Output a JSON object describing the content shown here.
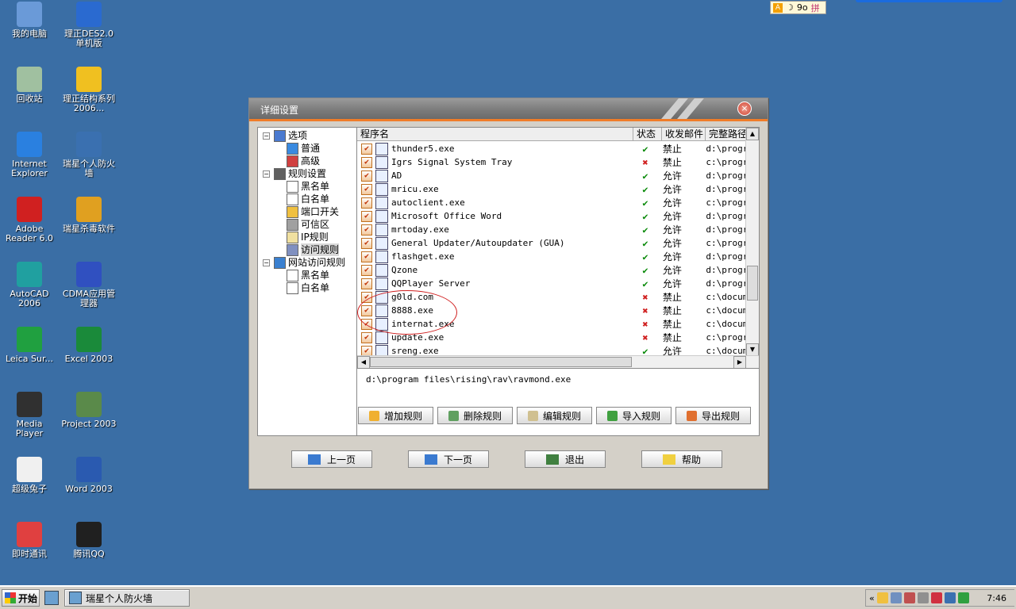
{
  "desktop_icons": [
    {
      "label": "我的电脑",
      "icon": "computer-icon",
      "color": "#6a9ad8"
    },
    {
      "label": "理正DES2.0单机版",
      "icon": "app-des-icon",
      "color": "#2a6ad0"
    },
    {
      "label": "回收站",
      "icon": "recycle-bin-icon",
      "color": "#a0c0a0"
    },
    {
      "label": "理正结构系列2006...",
      "icon": "app-lizheng-icon",
      "color": "#f0c020"
    },
    {
      "label": "Internet Explorer",
      "icon": "ie-icon",
      "color": "#2a80e0"
    },
    {
      "label": "瑞星个人防火墙",
      "icon": "firewall-icon",
      "color": "#3a70b0"
    },
    {
      "label": "Adobe Reader 6.0",
      "icon": "adobe-icon",
      "color": "#d02020"
    },
    {
      "label": "瑞星杀毒软件",
      "icon": "antivirus-icon",
      "color": "#e0a020"
    },
    {
      "label": "AutoCAD 2006",
      "icon": "autocad-icon",
      "color": "#20a0a0"
    },
    {
      "label": "CDMA应用管理器",
      "icon": "cdma-icon",
      "color": "#3050c0"
    },
    {
      "label": "Leica Sur...",
      "icon": "leica-icon",
      "color": "#20a040"
    },
    {
      "label": "Excel 2003",
      "icon": "excel-icon",
      "color": "#1a8a3a"
    },
    {
      "label": "Media Player",
      "icon": "media-player-icon",
      "color": "#303030"
    },
    {
      "label": "Project 2003",
      "icon": "project-icon",
      "color": "#5a8a4a"
    },
    {
      "label": "超级兔子",
      "icon": "rabbit-icon",
      "color": "#f0f0f0"
    },
    {
      "label": "Word 2003",
      "icon": "word-icon",
      "color": "#2a5ab0"
    },
    {
      "label": "即时通讯",
      "icon": "im-icon",
      "color": "#e04040"
    },
    {
      "label": "腾讯QQ",
      "icon": "qq-icon",
      "color": "#202020"
    }
  ],
  "ime": {
    "a": "A",
    "moon": "☽",
    "mode": "9o",
    "pin": "拼"
  },
  "dialog": {
    "title": "详细设置",
    "close": "×",
    "tree": [
      {
        "label": "选项",
        "icon": "options-icon"
      },
      {
        "label": "普通",
        "icon": "normal-settings-icon"
      },
      {
        "label": "高级",
        "icon": "advanced-settings-icon"
      },
      {
        "label": "规则设置",
        "icon": "rules-icon"
      },
      {
        "label": "黑名单",
        "icon": "blacklist-icon"
      },
      {
        "label": "白名单",
        "icon": "whitelist-icon"
      },
      {
        "label": "端口开关",
        "icon": "port-switch-icon"
      },
      {
        "label": "可信区",
        "icon": "trusted-zone-icon"
      },
      {
        "label": "IP规则",
        "icon": "ip-rules-icon"
      },
      {
        "label": "访问规则",
        "icon": "access-rules-icon"
      },
      {
        "label": "网站访问规则",
        "icon": "website-rules-icon"
      },
      {
        "label": "黑名单",
        "icon": "blacklist-icon"
      },
      {
        "label": "白名单",
        "icon": "whitelist-icon"
      }
    ],
    "columns": {
      "name": "程序名",
      "status": "状态",
      "mail": "收发邮件",
      "path": "完整路径"
    },
    "rows": [
      {
        "name": "thunder5.exe",
        "status": "ok",
        "mail": "禁止",
        "path": "d:\\progr"
      },
      {
        "name": "Igrs Signal System Tray",
        "status": "no",
        "mail": "禁止",
        "path": "c:\\progr"
      },
      {
        "name": "AD",
        "status": "ok",
        "mail": "允许",
        "path": "d:\\progr"
      },
      {
        "name": "mricu.exe",
        "status": "ok",
        "mail": "允许",
        "path": "d:\\progr"
      },
      {
        "name": "autoclient.exe",
        "status": "ok",
        "mail": "允许",
        "path": "c:\\progr"
      },
      {
        "name": "Microsoft Office Word",
        "status": "ok",
        "mail": "允许",
        "path": "d:\\progr"
      },
      {
        "name": "mrtoday.exe",
        "status": "ok",
        "mail": "允许",
        "path": "d:\\progr"
      },
      {
        "name": "General Updater/Autoupdater (GUA)",
        "status": "ok",
        "mail": "允许",
        "path": "c:\\progr"
      },
      {
        "name": "flashget.exe",
        "status": "ok",
        "mail": "允许",
        "path": "d:\\progr"
      },
      {
        "name": "Qzone",
        "status": "ok",
        "mail": "允许",
        "path": "d:\\progr"
      },
      {
        "name": "QQPlayer Server",
        "status": "ok",
        "mail": "允许",
        "path": "d:\\progr"
      },
      {
        "name": "g0ld.com",
        "status": "no",
        "mail": "禁止",
        "path": "c:\\docum"
      },
      {
        "name": "8888.exe",
        "status": "no",
        "mail": "禁止",
        "path": "c:\\docum"
      },
      {
        "name": "internat.exe",
        "status": "no",
        "mail": "禁止",
        "path": "c:\\docum"
      },
      {
        "name": "update.exe",
        "status": "no",
        "mail": "禁止",
        "path": "c:\\progr"
      },
      {
        "name": "sreng.exe",
        "status": "ok",
        "mail": "允许",
        "path": "c:\\docum"
      }
    ],
    "selected_path": "d:\\program files\\rising\\rav\\ravmond.exe",
    "action_buttons": [
      "增加规则",
      "删除规则",
      "编辑规则",
      "导入规则",
      "导出规则"
    ],
    "nav_buttons": [
      "上一页",
      "下一页",
      "退出",
      "帮助"
    ],
    "glyphs": {
      "check": "✔",
      "cross": "✖",
      "up": "▲",
      "down": "▼",
      "left": "◀",
      "right": "▶",
      "minus": "−"
    }
  },
  "taskbar": {
    "start": "开始",
    "task": "瑞星个人防火墙",
    "tray_prefix": "«",
    "clock": "7:46"
  }
}
